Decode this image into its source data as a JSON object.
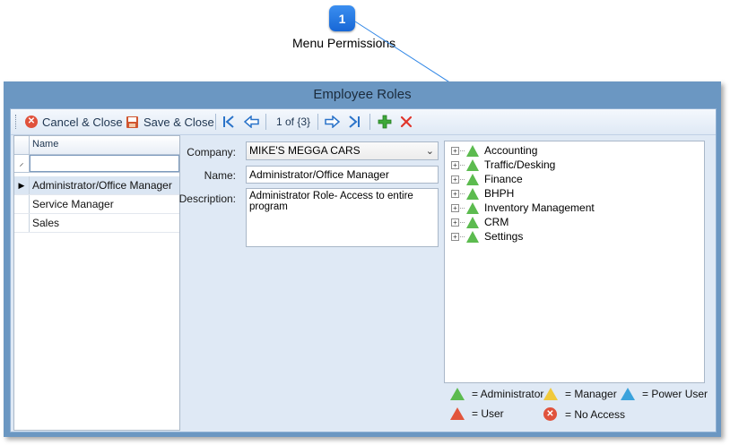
{
  "callout": {
    "number": "1",
    "label": "Menu Permissions"
  },
  "window": {
    "title": "Employee Roles"
  },
  "toolbar": {
    "cancel_close": "Cancel & Close",
    "save_close": "Save & Close",
    "record_position": "1 of {3}"
  },
  "grid": {
    "column_name": "Name",
    "rows": [
      "Administrator/Office Manager",
      "Service Manager",
      "Sales"
    ]
  },
  "form": {
    "company_label": "Company:",
    "company_value": "MIKE'S MEGGA CARS",
    "name_label": "Name:",
    "name_value": "Administrator/Office Manager",
    "description_label": "Description:",
    "description_value": "Administrator Role- Access to entire program"
  },
  "tree": {
    "items": [
      "Accounting",
      "Traffic/Desking",
      "Finance",
      "BHPH",
      "Inventory Management",
      "CRM",
      "Settings"
    ]
  },
  "legend": {
    "administrator": "= Administrator",
    "manager": "= Manager",
    "power_user": "= Power User",
    "user": "= User",
    "no_access": "= No Access"
  },
  "colors": {
    "administrator": "#5cbb4f",
    "manager": "#f0c93c",
    "power_user": "#3aa2dc",
    "user": "#e2553c",
    "no_access": "#e0523c"
  }
}
